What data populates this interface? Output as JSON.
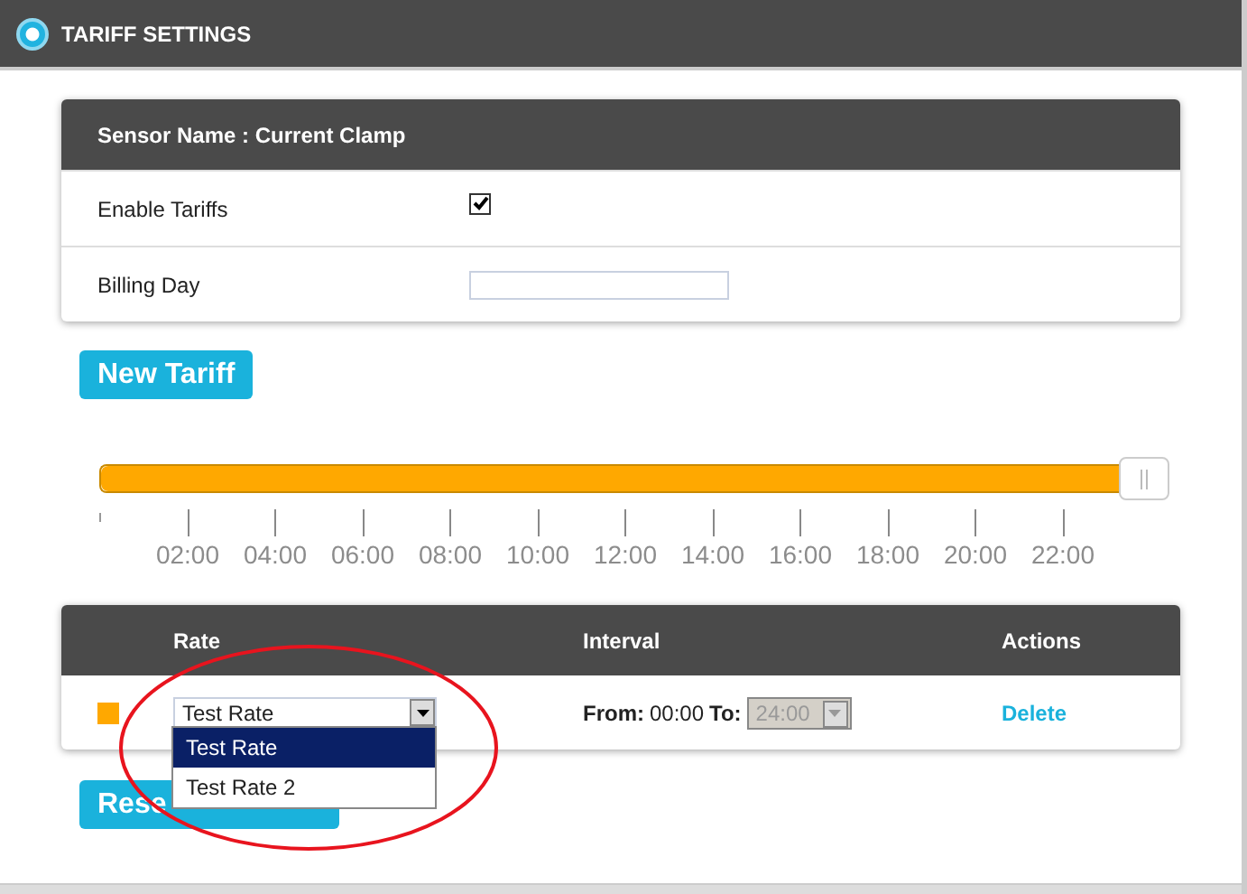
{
  "header": {
    "title": "TARIFF SETTINGS"
  },
  "sensor_card": {
    "title": "Sensor Name : Current Clamp",
    "rows": [
      {
        "kind": "checkbox",
        "label": "Enable Tariffs",
        "checked": true
      },
      {
        "kind": "input",
        "label": "Billing Day"
      }
    ]
  },
  "new_tariff_button": "New Tariff",
  "timeline": {
    "level": 1,
    "ticks": [
      "02:00",
      "04:00",
      "06:00",
      "08:00",
      "10:00",
      "12:00",
      "14:00",
      "16:00",
      "18:00",
      "20:00",
      "22:00"
    ]
  },
  "rates_table": {
    "columns": [
      "Rate",
      "Interval",
      "Actions"
    ],
    "rows": [
      {
        "color": "#ffa800",
        "rate": "Test Rate",
        "from_label": "From:",
        "from": "00:00",
        "to_label": "To:",
        "to": "24:00",
        "to_disabled": true,
        "action": "Delete"
      }
    ]
  },
  "rate_dropdown": {
    "options": [
      {
        "label": "Test Rate",
        "selected": true
      },
      {
        "label": "Test Rate 2",
        "selected": false
      }
    ]
  },
  "reset_button": "Rese"
}
